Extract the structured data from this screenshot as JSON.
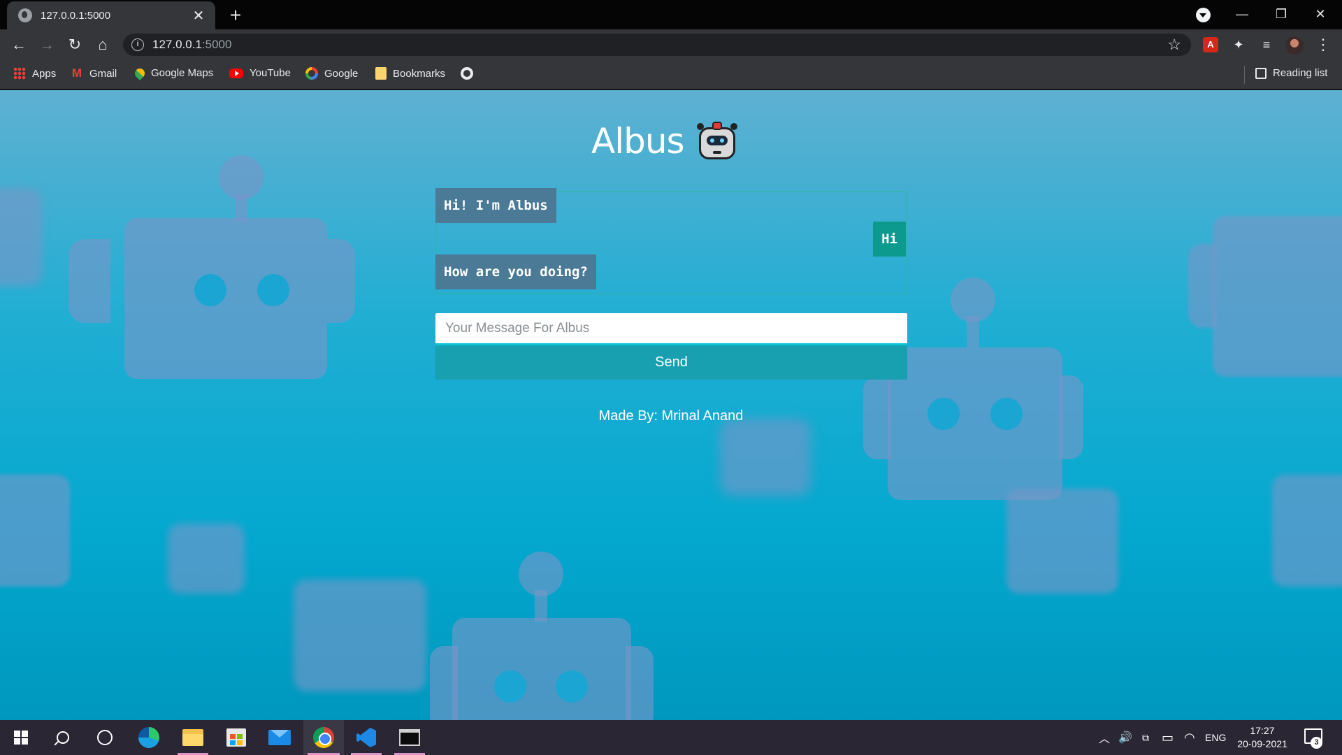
{
  "browser": {
    "tab_title": "127.0.0.1:5000",
    "tab_close": "✕",
    "new_tab": "+",
    "url_host": "127.0.0.1",
    "url_port": ":5000",
    "window_controls": {
      "minimize": "—",
      "restore": "❐",
      "close": "✕"
    },
    "nav_icons": {
      "back": "←",
      "forward": "→",
      "reload": "↻",
      "home": "⌂",
      "star": "☆",
      "menu": "⋮"
    },
    "bookmarks": [
      {
        "label": "Apps",
        "icon": "apps-icon"
      },
      {
        "label": "Gmail",
        "icon": "gmail-icon"
      },
      {
        "label": "Google Maps",
        "icon": "maps-icon"
      },
      {
        "label": "YouTube",
        "icon": "youtube-icon"
      },
      {
        "label": "Google",
        "icon": "google-icon"
      },
      {
        "label": "Bookmarks",
        "icon": "folder-icon"
      },
      {
        "label": "",
        "icon": "github-icon"
      }
    ],
    "reading_list": "Reading list"
  },
  "app": {
    "title": "Albus",
    "messages": [
      {
        "sender": "bot",
        "text": "Hi! I'm Albus"
      },
      {
        "sender": "user",
        "text": "Hi"
      },
      {
        "sender": "bot",
        "text": "How are you doing?"
      }
    ],
    "input_placeholder": "Your Message For Albus",
    "send_label": "Send",
    "credit": "Made By: Mrinal Anand",
    "colors": {
      "bot_bubble": "#4b7a96",
      "user_bubble": "#0d9a8e",
      "send_button": "#189fb0",
      "background": "#04a8cf"
    }
  },
  "taskbar": {
    "apps": [
      "start",
      "search",
      "cortana",
      "edge",
      "file-explorer",
      "store",
      "mail",
      "chrome",
      "vscode",
      "terminal"
    ],
    "tray": {
      "language": "ENG",
      "time": "17:27",
      "date": "20-09-2021",
      "notifications": "3"
    },
    "tray_glyphs": {
      "chevron": "︿",
      "volume": "🔊",
      "battery": "▭",
      "wifi": "◠"
    }
  }
}
